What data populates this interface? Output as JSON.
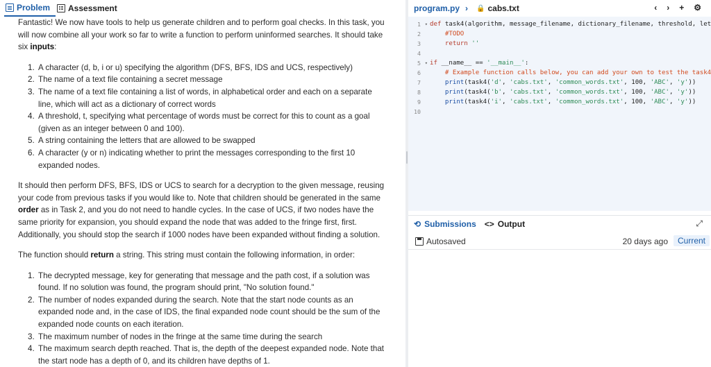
{
  "left_tabs": [
    {
      "label": "Problem",
      "icon": "document-icon",
      "active": true
    },
    {
      "label": "Assessment",
      "icon": "checklist-icon",
      "active": false
    }
  ],
  "problem": {
    "intro_pre": "Fantastic! We now have tools to help us generate children and to perform goal checks. In this task, you will now combine all your work so far to write a function to perform uninformed searches. It should take six ",
    "intro_bold": "inputs",
    "intro_post": ":",
    "inputs": [
      "A character (d, b, i or u) specifying the algorithm (DFS, BFS, IDS and UCS, respectively)",
      "The name of a text file containing a secret message",
      "The name of a text file containing a list of words, in alphabetical order and each on a separate line, which will act as a dictionary of correct words",
      "A threshold, t, specifying what percentage of words must be correct for this to count as a goal (given as an integer between 0 and 100).",
      "A string containing the letters that are allowed to be swapped",
      "A character (y or n) indicating whether to print the messages corresponding to the first 10 expanded nodes."
    ],
    "para2_pre": "It should then perform DFS, BFS, IDS or UCS to search for a decryption to the given message, reusing your code from previous tasks if you would like to. Note that children should be generated in the same ",
    "para2_bold": "order",
    "para2_post": " as in Task 2, and you do not need to handle cycles. In the case of UCS, if two nodes have the same priority for expansion, you should expand the node that was added to the fringe first, first. Additionally, you should stop the search if 1000 nodes have been expanded without finding a solution.",
    "para3_pre": "The function should ",
    "para3_bold": "return",
    "para3_post": " a string. This string must contain the following information, in order:",
    "outputs": [
      "The decrypted message, key for generating that message and the path cost, if a solution was found. If no solution was found, the program should print, \"No solution found.\"",
      "The number of nodes expanded during the search. Note that the start node counts as an expanded node and, in the case of IDS, the final expanded node count should be the sum of the expanded node counts on each iteration.",
      "The maximum number of nodes in the fringe at the same time during the search",
      "The maximum search depth reached. That is, the depth of the deepest expanded node. Note that the start node has a depth of 0, and its children have depths of 1."
    ]
  },
  "editor": {
    "tabs": [
      {
        "label": "program.py",
        "chevron": "›",
        "active": true
      },
      {
        "label": "cabs.txt",
        "lock": "🔒",
        "active": false
      }
    ],
    "actions": [
      "‹",
      "›",
      "+",
      "⚙"
    ],
    "line_numbers": [
      "1",
      "2",
      "3",
      "4",
      "5",
      "6",
      "7",
      "8",
      "9",
      "10"
    ]
  },
  "bottom": {
    "tabs": [
      {
        "label": "Submissions",
        "icon": "history-icon",
        "active": true
      },
      {
        "label": "Output",
        "icon": "code-icon",
        "active": false
      }
    ],
    "expand_icon": "⤢",
    "status": "Autosaved",
    "when": "20 days ago",
    "badge": "Current"
  },
  "colors": {
    "accent": "#1f5fa8",
    "keyword": "#b53c2c",
    "string": "#2e8b57",
    "comment": "#d14a1e",
    "editor_bg": "#f1f5fb"
  }
}
